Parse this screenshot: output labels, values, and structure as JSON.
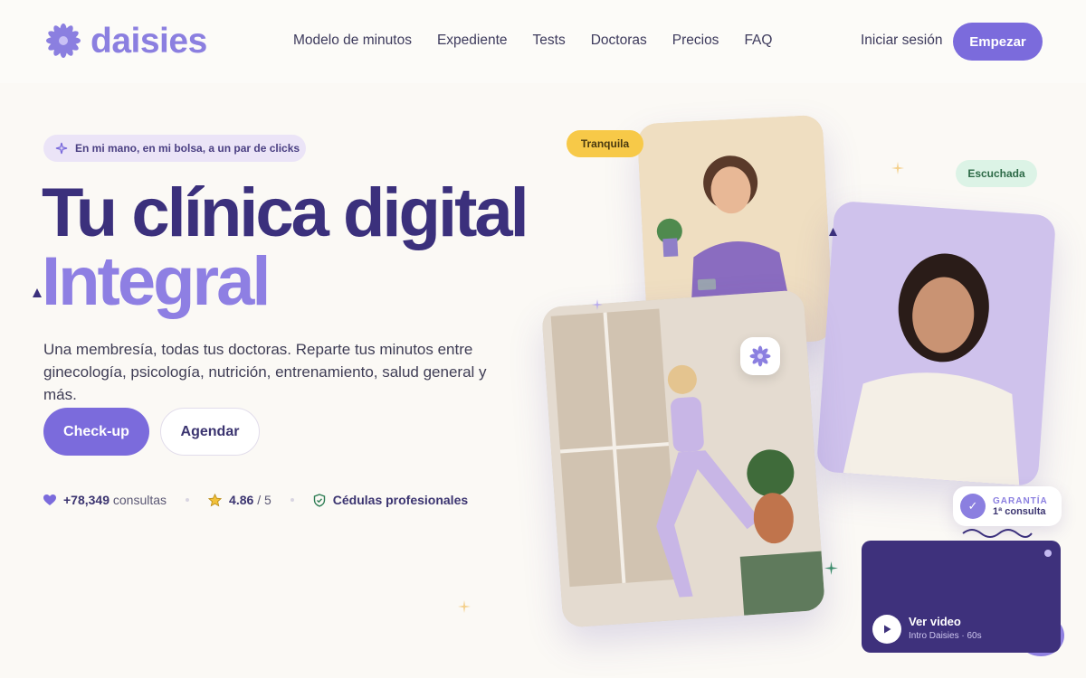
{
  "nav": {
    "logo_text": "daisies",
    "links": [
      "Modelo de minutos",
      "Expediente",
      "Tests",
      "Doctoras",
      "Precios",
      "FAQ"
    ],
    "login": "Iniciar sesión",
    "cta": "Empezar"
  },
  "hero": {
    "pill": "En mi mano, en mi bolsa, a un par de clicks",
    "title_line1": "Tu clínica digital",
    "title_line2": "Integral",
    "subtitle": "Una membresía, todas tus doctoras. Reparte tus minutos entre ginecología, psicología, nutrición, entrenamiento, salud general y más.",
    "btn_primary": "Check-up",
    "btn_secondary": "Agendar",
    "stats": {
      "consultas_value": "+78,349",
      "consultas_label": "consultas",
      "rating_value": "4.86",
      "rating_suffix": "/ 5",
      "cedulas": "Cédulas profesionales"
    }
  },
  "media": {
    "tag_tranquila": "Tranquila",
    "tag_escuchada": "Escuchada",
    "guarantee_title": "GARANTÍA",
    "guarantee_sub": "1ª consulta",
    "video_title": "Ver video",
    "video_sub": "Intro Daisies · 60s"
  },
  "colors": {
    "brand": "#7b6bdc",
    "brand_dark": "#3b307c",
    "accent_yellow": "#f7c948",
    "accent_green": "#dcf3e6"
  }
}
